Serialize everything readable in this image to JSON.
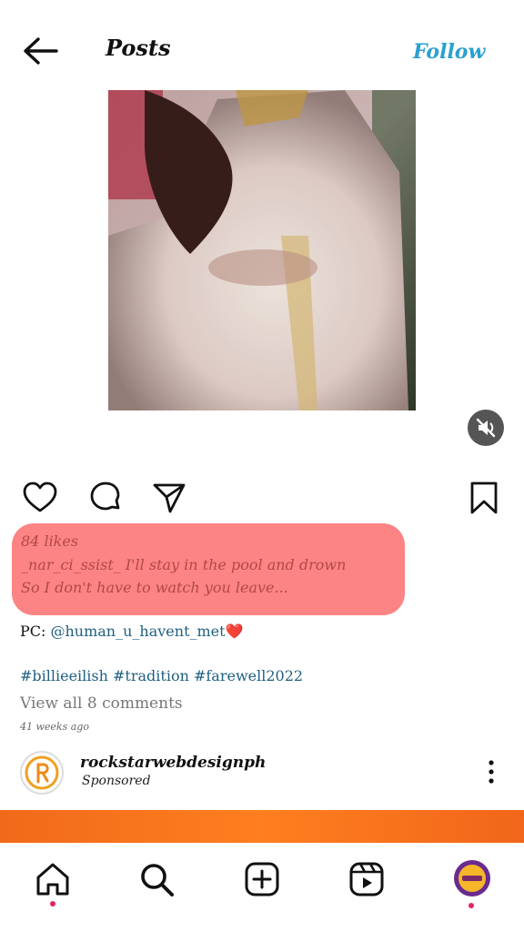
{
  "header": {
    "title": "Posts",
    "follow_label": "Follow"
  },
  "post": {
    "likes": "84 likes",
    "username": "_nar_ci_ssist_",
    "caption_line1": " I'll stay in the pool and drown",
    "caption_line2": "So I don't have to watch you leave...",
    "pc_prefix": "PC: ",
    "pc_user": "@human_u_havent_met",
    "heart_emoji": "❤️",
    "hashtags": "#billieeilish #tradition #farewell2022",
    "view_comments": "View all 8 comments",
    "time_ago": "41 weeks ago"
  },
  "sponsored": {
    "name": "rockstarwebdesignph",
    "label": "Sponsored"
  },
  "icons": {
    "back": "arrow-left-icon",
    "mute": "speaker-muted-icon",
    "like": "heart-icon",
    "comment": "comment-bubble-icon",
    "share": "paper-plane-icon",
    "save": "bookmark-icon",
    "more": "vertical-dots-icon",
    "home": "home-icon",
    "search": "search-icon",
    "create": "plus-square-icon",
    "reels": "reels-icon",
    "profile": "profile-avatar-icon"
  },
  "colors": {
    "accent": "#2aa0d0",
    "highlight": "#fc8484",
    "notification": "#e0245e",
    "banner": "#f06a1a"
  }
}
